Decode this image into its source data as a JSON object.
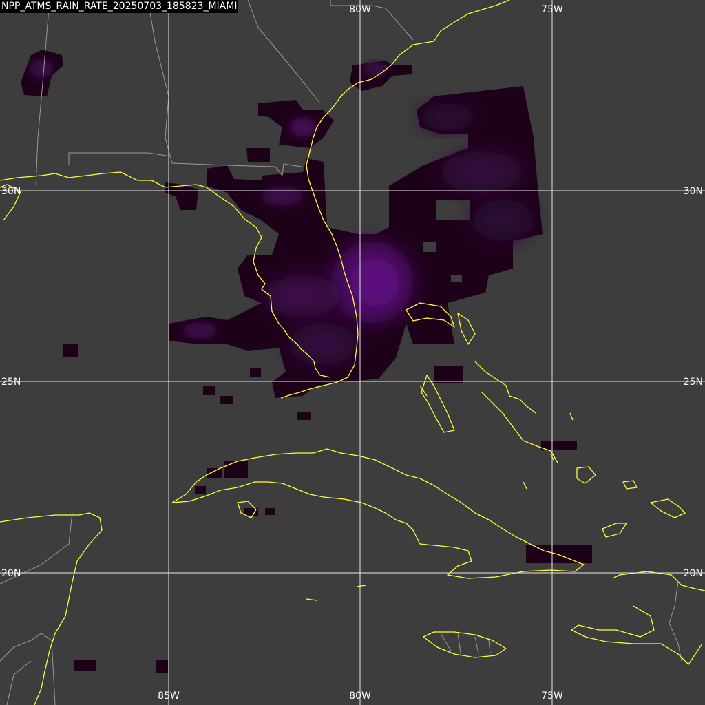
{
  "product_label": "NPP_ATMS_RAIN_RATE_20250703_185823_MIAMI",
  "colors": {
    "background": "#3d3d3d",
    "coastline": "#ffff33",
    "borders": "#9a9a9a",
    "graticule": "#e6e6e6",
    "rain_dark": "#1a0016",
    "rain_mid": "#3a0a40",
    "rain_core": "#5a0a78"
  },
  "graticule": {
    "longitude_labels_top": [
      "80W",
      "75W"
    ],
    "longitude_labels_bottom": [
      "85W",
      "80W",
      "75W"
    ],
    "latitude_labels_left": [
      "30N",
      "25N",
      "20N"
    ],
    "latitude_labels_right": [
      "30N",
      "25N",
      "20N"
    ]
  },
  "layers": {
    "coastlines": "coastline-layer",
    "political_borders": "border-layer",
    "precipitation": "rain-rate-layer"
  }
}
